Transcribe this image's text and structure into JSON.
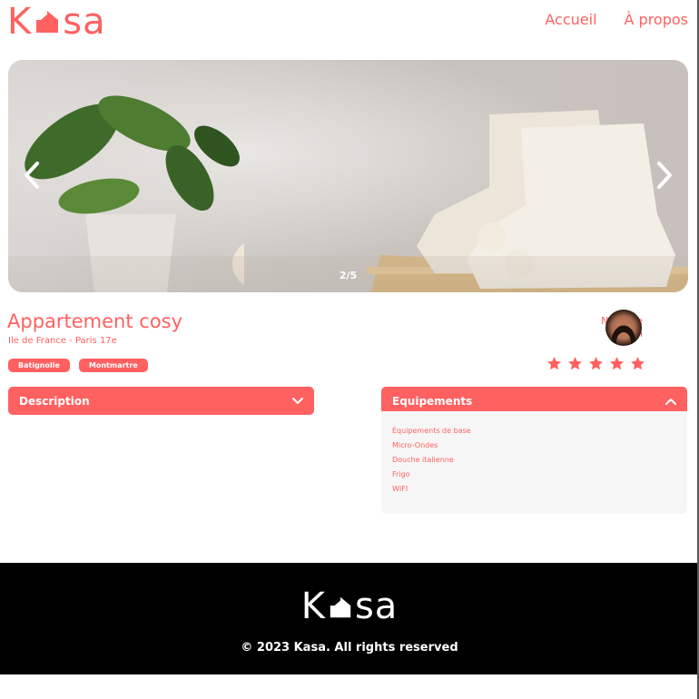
{
  "header": {
    "logo_left": "K",
    "logo_right": "sa",
    "nav": [
      {
        "label": "Accueil"
      },
      {
        "label": "À propos"
      }
    ]
  },
  "carousel": {
    "counter": "2/5",
    "current": 2,
    "total": 5
  },
  "listing": {
    "title": "Appartement cosy",
    "location": "Ile de France - Paris 17e",
    "tags": [
      "Batignolle",
      "Montmartre"
    ],
    "host": {
      "first_name": "Nathalie",
      "last_name": "Jean"
    },
    "rating": 5,
    "rating_max": 5
  },
  "collapses": {
    "description": {
      "label": "Description",
      "expanded": false
    },
    "equipments": {
      "label": "Equipements",
      "expanded": true,
      "items": [
        "Équipements de base",
        "Micro-Ondes",
        "Douche italienne",
        "Frigo",
        "WIFI"
      ]
    }
  },
  "footer": {
    "logo_left": "K",
    "logo_right": "sa",
    "copyright": "© 2023 Kasa. All rights reserved"
  },
  "colors": {
    "accent": "#FF6060",
    "panel": "#F6F6F6",
    "footer_bg": "#000000"
  }
}
